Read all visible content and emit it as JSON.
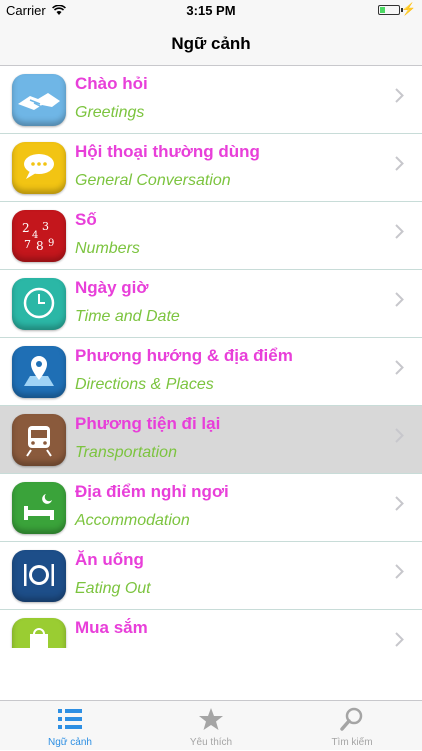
{
  "status_bar": {
    "carrier": "Carrier",
    "time": "3:15 PM",
    "battery_level": 0.2
  },
  "nav": {
    "title": "Ngữ cảnh"
  },
  "items": [
    {
      "vn": "Chào hỏi",
      "en": "Greetings",
      "icon": "handshake-icon",
      "color": "#6fb6e6"
    },
    {
      "vn": "Hội thoại thường dùng",
      "en": "General Conversation",
      "icon": "speech-bubble-icon",
      "color": "#f2c413"
    },
    {
      "vn": "Số",
      "en": "Numbers",
      "icon": "numbers-icon",
      "color": "#c4161c"
    },
    {
      "vn": "Ngày giờ",
      "en": "Time and Date",
      "icon": "clock-icon",
      "color": "#2bb7a6"
    },
    {
      "vn": "Phương hướng & địa điểm",
      "en": "Directions & Places",
      "icon": "map-pin-icon",
      "color": "#1f6fb5"
    },
    {
      "vn": "Phương tiện đi lại",
      "en": "Transportation",
      "icon": "train-icon",
      "color": "#8a5a3c",
      "selected": true
    },
    {
      "vn": "Địa điểm nghỉ ngơi",
      "en": "Accommodation",
      "icon": "bed-icon",
      "color": "#3aa33a"
    },
    {
      "vn": "Ăn uống",
      "en": "Eating Out",
      "icon": "plate-icon",
      "color": "#1d4e89"
    },
    {
      "vn": "Mua sắm",
      "en": "",
      "icon": "shopping-bag-icon",
      "color": "#9acd32"
    }
  ],
  "tabs": [
    {
      "label": "Ngữ cảnh",
      "icon": "list-icon",
      "active": true
    },
    {
      "label": "Yêu thích",
      "icon": "star-icon",
      "active": false
    },
    {
      "label": "Tìm kiếm",
      "icon": "magnifier-icon",
      "active": false
    }
  ],
  "colors": {
    "accent": "#2d8fe3",
    "vn_text": "#e83fd9",
    "en_text": "#7cc43f",
    "tab_inactive": "#a5a5a5"
  }
}
